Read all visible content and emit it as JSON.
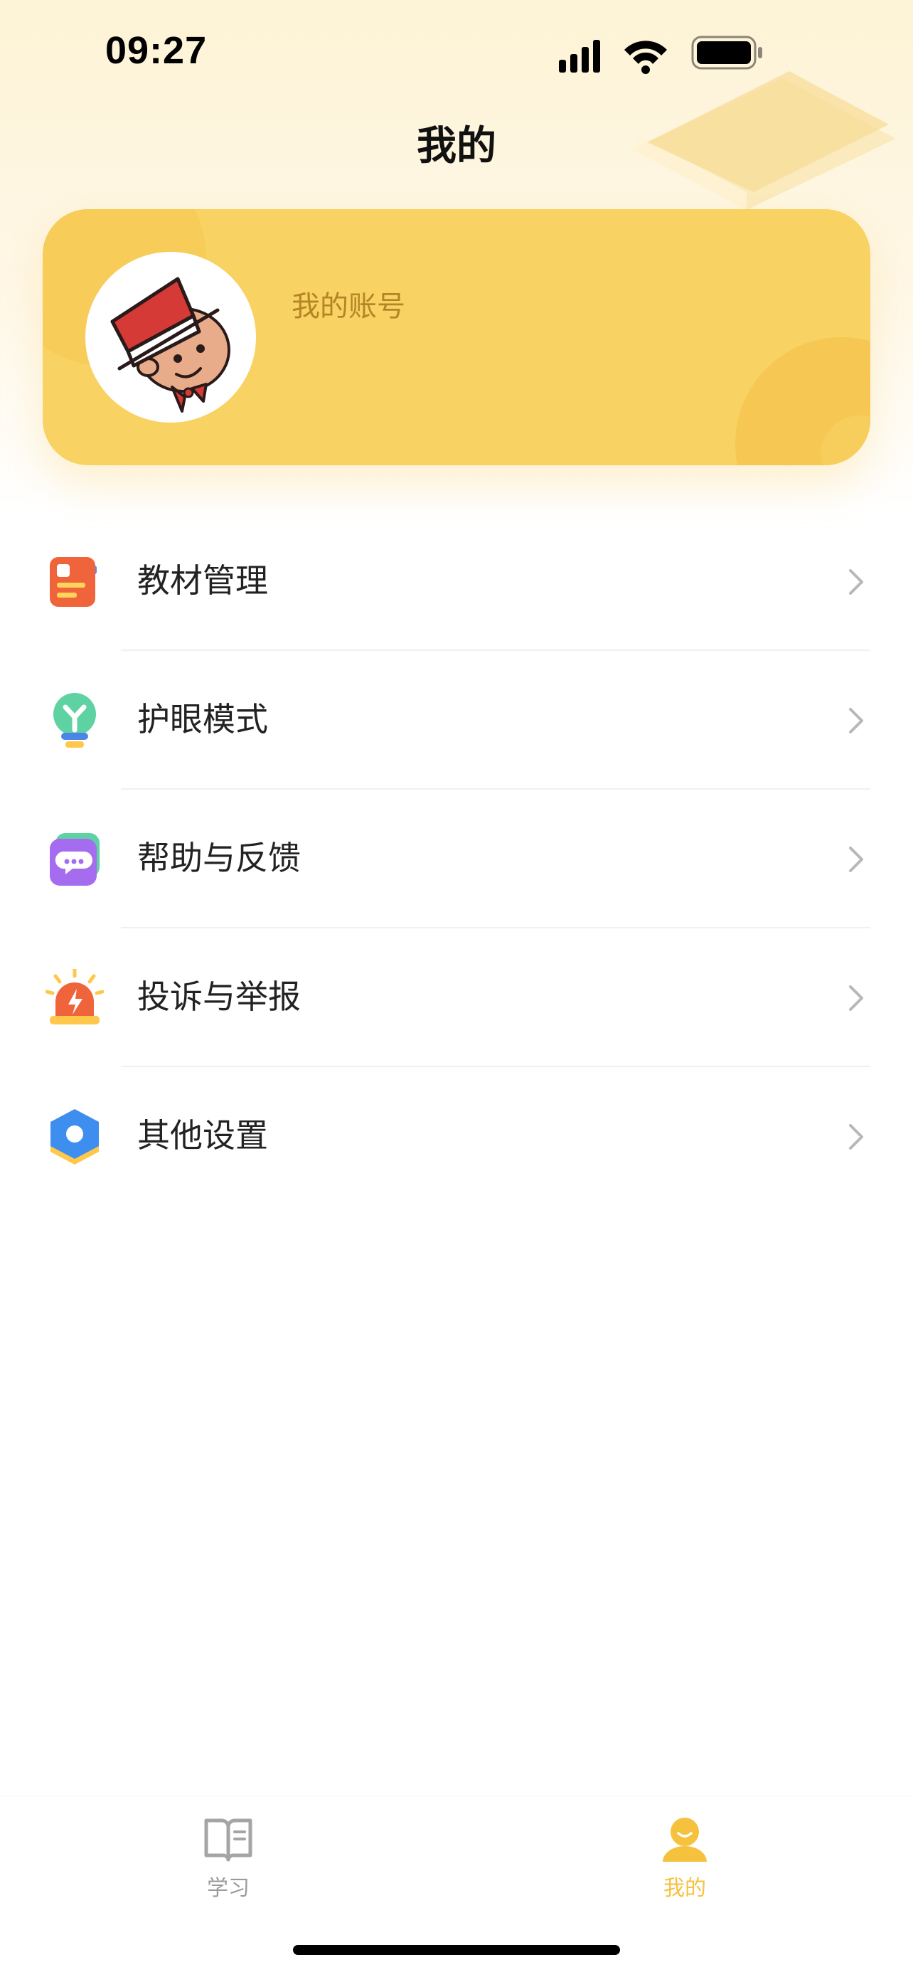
{
  "status_bar": {
    "time": "09:27"
  },
  "header": {
    "title": "我的"
  },
  "profile": {
    "account_label": "我的账号"
  },
  "menu": [
    {
      "label": "教材管理",
      "icon": "textbook-icon"
    },
    {
      "label": "护眼模式",
      "icon": "eye-care-bulb-icon"
    },
    {
      "label": "帮助与反馈",
      "icon": "chat-bubble-icon"
    },
    {
      "label": "投诉与举报",
      "icon": "alarm-siren-icon"
    },
    {
      "label": "其他设置",
      "icon": "hexagon-settings-icon"
    }
  ],
  "tabbar": {
    "tabs": [
      {
        "label": "学习",
        "icon": "book-icon",
        "active": false
      },
      {
        "label": "我的",
        "icon": "person-icon",
        "active": true
      }
    ]
  },
  "colors": {
    "accent": "#f8d262",
    "active_tab": "#f6c23e",
    "inactive_tab": "#9a9a9a",
    "account_text": "#b48526"
  }
}
